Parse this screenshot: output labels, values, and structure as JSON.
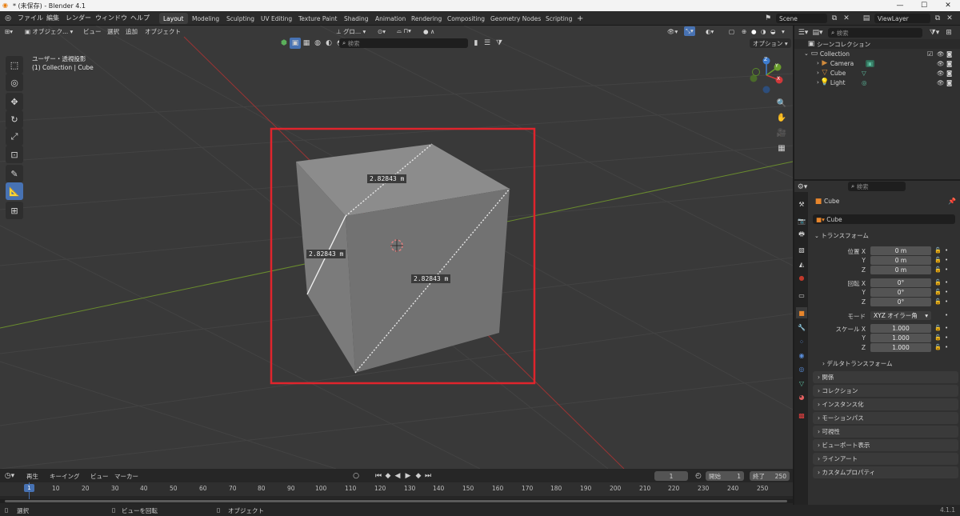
{
  "window": {
    "title": "* (未保存) - Blender 4.1"
  },
  "menus": [
    "ファイル",
    "編集",
    "レンダー",
    "ウィンドウ",
    "ヘルプ"
  ],
  "workspaces": [
    {
      "label": "Layout",
      "active": true
    },
    {
      "label": "Modeling",
      "active": false
    },
    {
      "label": "Sculpting",
      "active": false
    },
    {
      "label": "UV Editing",
      "active": false
    },
    {
      "label": "Texture Paint",
      "active": false
    },
    {
      "label": "Shading",
      "active": false
    },
    {
      "label": "Animation",
      "active": false
    },
    {
      "label": "Rendering",
      "active": false
    },
    {
      "label": "Compositing",
      "active": false
    },
    {
      "label": "Geometry Nodes",
      "active": false
    },
    {
      "label": "Scripting",
      "active": false
    }
  ],
  "add_workspace": "+",
  "scene": {
    "label": "Scene"
  },
  "view_layer": {
    "label": "ViewLayer"
  },
  "viewport_header": {
    "mode": "オブジェク...",
    "menu_view": "ビュー",
    "menu_select": "選択",
    "menu_add": "追加",
    "menu_object": "オブジェクト",
    "orientation": "グロ...",
    "search_placeholder": "検索",
    "options": "オプション"
  },
  "viewport": {
    "view_name": "ユーザー・透視投影",
    "context": "(1) Collection | Cube",
    "measure_labels": [
      "2.82843 m",
      "2.82843 m",
      "2.82843 m"
    ],
    "gizmo": {
      "x": "X",
      "y": "Y",
      "z": "Z"
    },
    "highlight_color": "#e0242c"
  },
  "outliner": {
    "search_placeholder": "検索",
    "root": "シーンコレクション",
    "collection": "Collection",
    "items": [
      {
        "name": "Camera",
        "icon": "camera-icon"
      },
      {
        "name": "Cube",
        "icon": "mesh-icon"
      },
      {
        "name": "Light",
        "icon": "light-icon"
      }
    ]
  },
  "properties": {
    "search_placeholder": "検索",
    "object_name": "Cube",
    "data_name": "Cube",
    "transform_header": "トランスフォーム",
    "location_label": "位置 X",
    "location": [
      "0 m",
      "0 m",
      "0 m"
    ],
    "rotation_label": "回転 X",
    "rotation": [
      "0°",
      "0°",
      "0°"
    ],
    "axis_y": "Y",
    "axis_z": "Z",
    "mode_label": "モード",
    "mode_value": "XYZ オイラー角",
    "scale_label": "スケール X",
    "scale": [
      "1.000",
      "1.000",
      "1.000"
    ],
    "delta_transform": "デルタトランスフォーム",
    "panels": [
      "関係",
      "コレクション",
      "インスタンス化",
      "モーションパス",
      "可視性",
      "ビューポート表示",
      "ラインアート",
      "カスタムプロパティ"
    ]
  },
  "timeline": {
    "menus": [
      "再生",
      "キーイング",
      "ビュー",
      "マーカー"
    ],
    "current_frame": "1",
    "start_label": "開始",
    "start": "1",
    "end_label": "終了",
    "end": "250",
    "ticks": [
      "1",
      "10",
      "20",
      "30",
      "40",
      "50",
      "60",
      "70",
      "80",
      "90",
      "100",
      "110",
      "120",
      "130",
      "140",
      "150",
      "160",
      "170",
      "180",
      "190",
      "200",
      "210",
      "220",
      "230",
      "240",
      "250"
    ]
  },
  "statusbar": {
    "select": "選択",
    "rotate_view": "ビューを回転",
    "object": "オブジェクト",
    "version": "4.1.1"
  }
}
